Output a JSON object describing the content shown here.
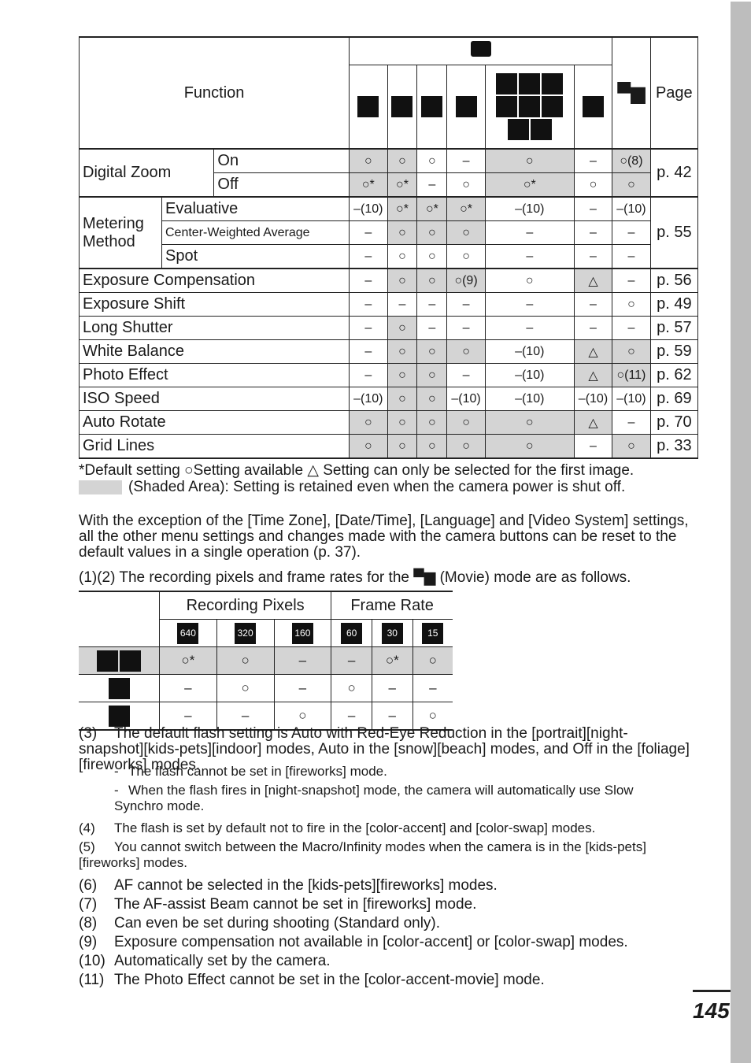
{
  "table": {
    "header": {
      "function": "Function",
      "still_icon": "camera-icon",
      "movie_icon": "movie-icon",
      "page": "Page",
      "mode_icons": [
        "auto-mode-icon",
        "manual-mode-icon",
        "digital-macro-icon",
        "stitch-assist-icon",
        "scene-modes-icon",
        "color-accent-icon"
      ]
    },
    "rows": [
      {
        "function": "Digital Zoom",
        "sub": "On",
        "cells": [
          "○",
          "○",
          "○",
          "–",
          "○",
          "–",
          "○(8)"
        ],
        "shade": [
          1,
          1,
          0,
          0,
          1,
          0,
          1
        ],
        "page": "p. 42"
      },
      {
        "function": "",
        "sub": "Off",
        "cells": [
          "○*",
          "○*",
          "–",
          "○",
          "○*",
          "○",
          "○"
        ],
        "shade": [
          1,
          1,
          0,
          0,
          1,
          0,
          1
        ],
        "page": ""
      },
      {
        "function": "Metering Method",
        "sub": "Evaluative",
        "cells": [
          "–(10)",
          "○*",
          "○*",
          "○*",
          "–(10)",
          "–",
          "–(10)"
        ],
        "shade": [
          0,
          1,
          1,
          1,
          0,
          0,
          0
        ],
        "page": "p. 55"
      },
      {
        "function": "",
        "sub": "Center-Weighted Average",
        "cells": [
          "–",
          "○",
          "○",
          "○",
          "–",
          "–",
          "–"
        ],
        "shade": [
          0,
          1,
          1,
          1,
          0,
          0,
          0
        ],
        "page": ""
      },
      {
        "function": "",
        "sub": "Spot",
        "cells": [
          "–",
          "○",
          "○",
          "○",
          "–",
          "–",
          "–"
        ],
        "shade": [
          0,
          0,
          0,
          0,
          0,
          0,
          0
        ],
        "page": ""
      },
      {
        "function": "Exposure Compensation",
        "cells": [
          "–",
          "○",
          "○",
          "○(9)",
          "○",
          "△",
          "–"
        ],
        "shade": [
          0,
          1,
          1,
          1,
          0,
          1,
          0
        ],
        "page": "p. 56"
      },
      {
        "function": "Exposure Shift",
        "cells": [
          "–",
          "–",
          "–",
          "–",
          "–",
          "–",
          "○"
        ],
        "shade": [
          0,
          0,
          0,
          0,
          0,
          0,
          0
        ],
        "page": "p. 49"
      },
      {
        "function": "Long Shutter",
        "cells": [
          "–",
          "○",
          "–",
          "–",
          "–",
          "–",
          "–"
        ],
        "shade": [
          0,
          1,
          0,
          0,
          0,
          0,
          0
        ],
        "page": "p. 57"
      },
      {
        "function": "White Balance",
        "cells": [
          "–",
          "○",
          "○",
          "○",
          "–(10)",
          "△",
          "○"
        ],
        "shade": [
          0,
          1,
          1,
          1,
          0,
          1,
          1
        ],
        "page": "p. 59"
      },
      {
        "function": "Photo Effect",
        "cells": [
          "–",
          "○",
          "○",
          "–",
          "–(10)",
          "△",
          "○(11)"
        ],
        "shade": [
          0,
          1,
          1,
          0,
          0,
          1,
          1
        ],
        "page": "p. 62"
      },
      {
        "function": "ISO Speed",
        "cells": [
          "–(10)",
          "○",
          "○",
          "–(10)",
          "–(10)",
          "–(10)",
          "–(10)"
        ],
        "shade": [
          0,
          1,
          1,
          0,
          0,
          0,
          0
        ],
        "page": "p. 69"
      },
      {
        "function": "Auto Rotate",
        "cells": [
          "○",
          "○",
          "○",
          "○",
          "○",
          "△",
          "–"
        ],
        "shade": [
          1,
          1,
          1,
          1,
          1,
          1,
          0
        ],
        "page": "p. 70"
      },
      {
        "function": "Grid Lines",
        "cells": [
          "○",
          "○",
          "○",
          "○",
          "○",
          "–",
          "○"
        ],
        "shade": [
          1,
          1,
          1,
          1,
          1,
          0,
          1
        ],
        "page": "p. 33"
      }
    ]
  },
  "legend": {
    "line1": "*Default setting ○Setting available △ Setting can only be selected for the first image.",
    "line2": "(Shaded Area): Setting is retained even when the camera power is shut off."
  },
  "reset_note": "With the exception of the [Time Zone], [Date/Time], [Language] and [Video System] settings, all the other menu settings and changes made with the camera buttons can be reset to the default values in a single operation (p. 37).",
  "movie_intro": {
    "before": "(1)(2) The recording pixels and frame rates for the",
    "after": "(Movie) mode are as follows."
  },
  "movie_table": {
    "groups": [
      "Recording Pixels",
      "Frame Rate"
    ],
    "cols": [
      "640",
      "320",
      "160",
      "60",
      "30",
      "15"
    ],
    "rows": [
      {
        "icon": "standard-movie-icon",
        "cells": [
          "○*",
          "○",
          "–",
          "–",
          "○*",
          "○"
        ]
      },
      {
        "icon": "fast-frame-rate-icon",
        "cells": [
          "–",
          "○",
          "–",
          "○",
          "–",
          "–"
        ]
      },
      {
        "icon": "compact-movie-icon",
        "cells": [
          "–",
          "–",
          "○",
          "–",
          "–",
          "○"
        ]
      }
    ]
  },
  "notes": [
    {
      "num": "(3)",
      "text": "The default flash setting is Auto with Red-Eye Reduction in the [portrait][night-snapshot][kids-pets][indoor] modes, Auto in the [snow][beach] modes, and Off in the [foliage][fireworks] modes."
    },
    {
      "num": "-",
      "text": "The flash cannot be set in [fireworks] mode."
    },
    {
      "num": "-",
      "text": "When the flash fires in [night-snapshot] mode, the camera will automatically use Slow Synchro mode."
    },
    {
      "num": "(4)",
      "text": "The flash is set by default not to fire in the [color-accent] and [color-swap] modes."
    },
    {
      "num": "(5)",
      "text": "You cannot switch between the Macro/Infinity modes when the camera is in the [kids-pets][fireworks] modes."
    },
    {
      "num": "(6)",
      "text": "AF cannot be selected in the [kids-pets][fireworks] modes."
    },
    {
      "num": "(7)",
      "text": "The AF-assist Beam cannot be set in [fireworks] mode."
    },
    {
      "num": "(8)",
      "text": "Can even be set during shooting (Standard only)."
    },
    {
      "num": "(9)",
      "text": "Exposure compensation not available in [color-accent] or [color-swap] modes."
    },
    {
      "num": "(10)",
      "text": "Automatically set by the camera."
    },
    {
      "num": "(11)",
      "text": "The Photo Effect cannot be set in the [color-accent-movie] mode."
    }
  ],
  "page_number": "145"
}
